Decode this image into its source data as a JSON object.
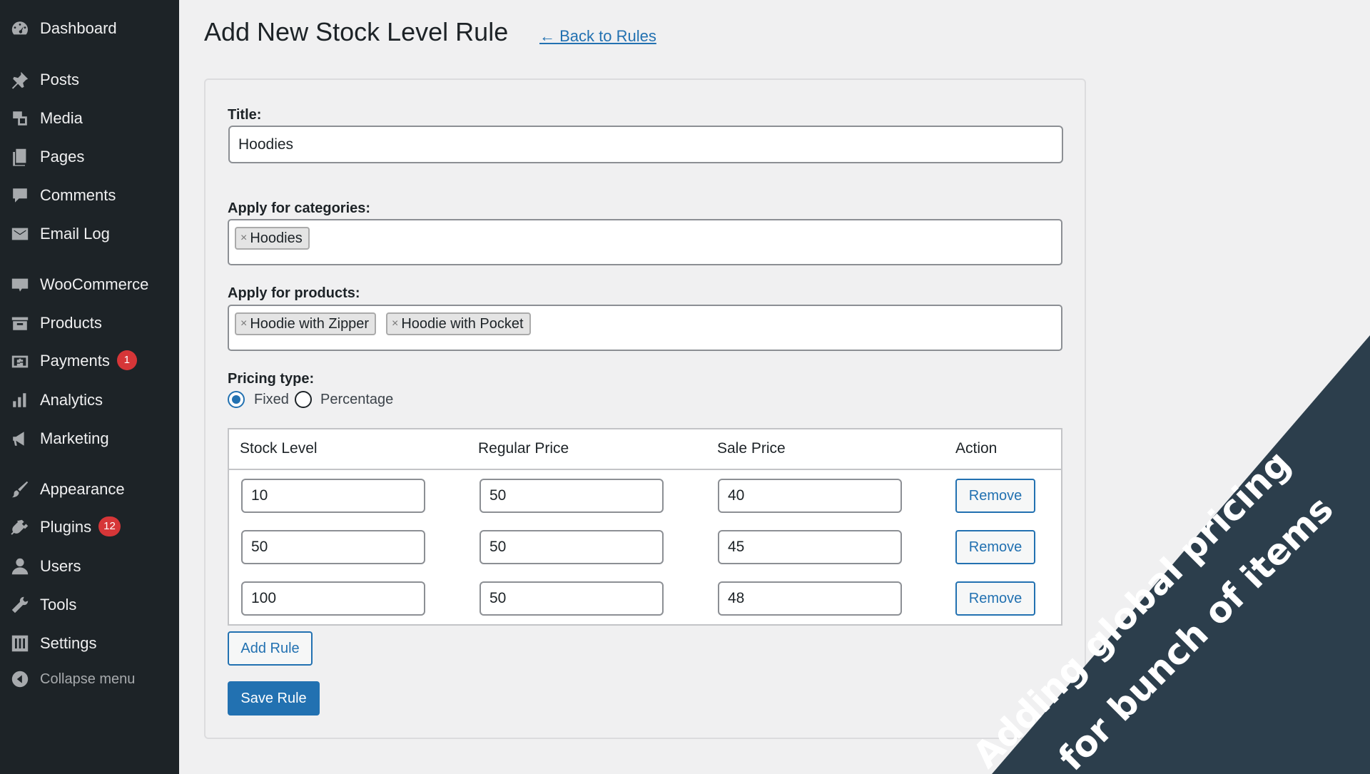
{
  "sidebar": {
    "items": [
      {
        "label": "Dashboard",
        "icon": "dashboard-icon",
        "badge": null
      },
      {
        "label": "Posts",
        "icon": "pin-icon",
        "badge": null
      },
      {
        "label": "Media",
        "icon": "media-icon",
        "badge": null
      },
      {
        "label": "Pages",
        "icon": "pages-icon",
        "badge": null
      },
      {
        "label": "Comments",
        "icon": "comment-icon",
        "badge": null
      },
      {
        "label": "Email Log",
        "icon": "email-icon",
        "badge": null
      },
      {
        "label": "WooCommerce",
        "icon": "woo-icon",
        "badge": null
      },
      {
        "label": "Products",
        "icon": "archive-icon",
        "badge": null
      },
      {
        "label": "Payments",
        "icon": "dollar-icon",
        "badge": "1"
      },
      {
        "label": "Analytics",
        "icon": "bar-chart-icon",
        "badge": null
      },
      {
        "label": "Marketing",
        "icon": "megaphone-icon",
        "badge": null
      },
      {
        "label": "Appearance",
        "icon": "brush-icon",
        "badge": null
      },
      {
        "label": "Plugins",
        "icon": "plug-icon",
        "badge": "12"
      },
      {
        "label": "Users",
        "icon": "user-icon",
        "badge": null
      },
      {
        "label": "Tools",
        "icon": "wrench-icon",
        "badge": null
      },
      {
        "label": "Settings",
        "icon": "sliders-icon",
        "badge": null
      }
    ],
    "collapse_label": "Collapse menu"
  },
  "header": {
    "title": "Add New Stock Level Rule",
    "back_link": "← Back to Rules"
  },
  "form": {
    "title_label": "Title:",
    "title_value": "Hoodies",
    "categories_label": "Apply for categories:",
    "categories": [
      "Hoodies"
    ],
    "products_label": "Apply for products:",
    "products": [
      "Hoodie with Zipper",
      "Hoodie with Pocket"
    ],
    "tag_remove": "×",
    "pricing_label": "Pricing type:",
    "pricing_options": [
      "Fixed",
      "Percentage"
    ],
    "pricing_selected": "Fixed"
  },
  "rules_table": {
    "columns": [
      "Stock Level",
      "Regular Price",
      "Sale Price",
      "Action"
    ],
    "rows": [
      {
        "stock": "10",
        "regular": "50",
        "sale": "40"
      },
      {
        "stock": "50",
        "regular": "50",
        "sale": "45"
      },
      {
        "stock": "100",
        "regular": "50",
        "sale": "48"
      }
    ],
    "remove_label": "Remove"
  },
  "actions": {
    "add_rule": "Add Rule",
    "save_rule": "Save Rule"
  },
  "banner": {
    "line1": "Adding global pricing",
    "line2": "for bunch of items",
    "color": "#2c3e4c"
  },
  "colors": {
    "sidebar_bg": "#1d2327",
    "accent": "#2271b1",
    "badge": "#d63638"
  }
}
